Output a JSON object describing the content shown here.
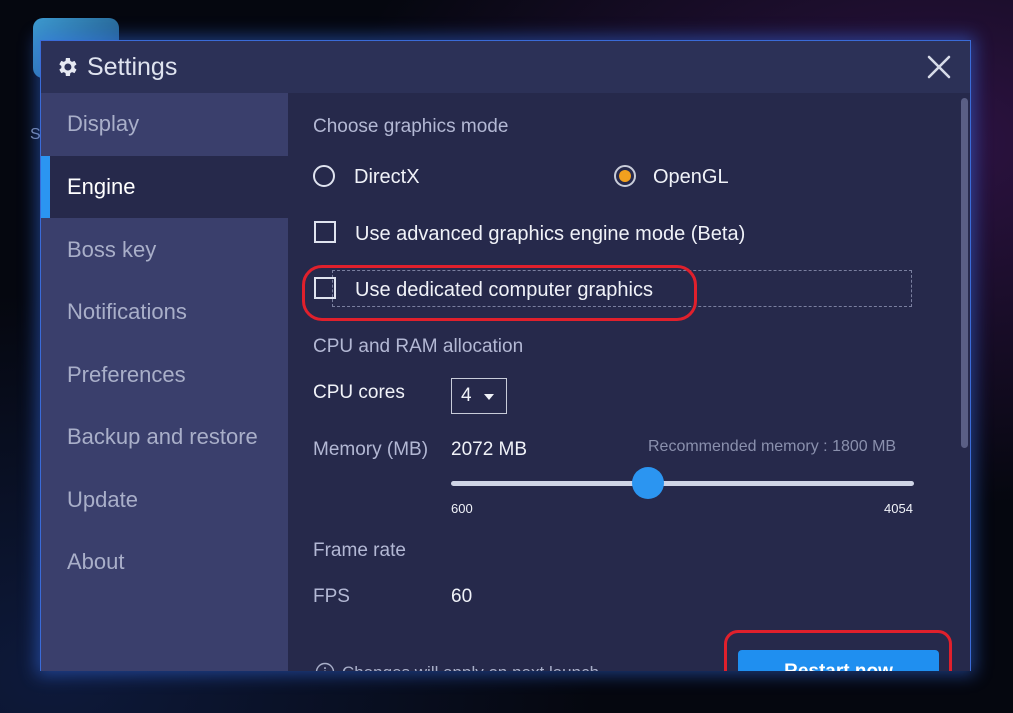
{
  "background": {
    "stray_text": "S"
  },
  "window": {
    "title": "Settings",
    "title_icon": "gear-icon",
    "close_icon": "close-icon"
  },
  "sidebar": {
    "items": [
      {
        "label": "Display",
        "active": false
      },
      {
        "label": "Engine",
        "active": true
      },
      {
        "label": "Boss key",
        "active": false
      },
      {
        "label": "Notifications",
        "active": false
      },
      {
        "label": "Preferences",
        "active": false
      },
      {
        "label": "Backup and restore",
        "active": false
      },
      {
        "label": "Update",
        "active": false
      },
      {
        "label": "About",
        "active": false
      }
    ]
  },
  "engine": {
    "graphics_mode_title": "Choose graphics mode",
    "graphics_modes": [
      {
        "label": "DirectX",
        "selected": false
      },
      {
        "label": "OpenGL",
        "selected": true
      }
    ],
    "advanced_engine_label": "Use advanced graphics engine mode (Beta)",
    "advanced_engine_checked": false,
    "dedicated_graphics_label": "Use dedicated computer graphics",
    "dedicated_graphics_checked": false,
    "cpu_ram_title": "CPU and RAM allocation",
    "cpu_cores_label": "CPU cores",
    "cpu_cores_value": "4",
    "memory_label": "Memory (MB)",
    "memory_value": "2072 MB",
    "recommended_memory": "Recommended memory : 1800 MB",
    "memory_min": "600",
    "memory_max": "4054",
    "memory_slider_value": 2072,
    "frame_rate_title": "Frame rate",
    "fps_label": "FPS",
    "fps_value": "60"
  },
  "footer": {
    "info_text": "Changes will apply on next launch",
    "restart_button": "Restart now"
  },
  "colors": {
    "accent": "#2b95f1",
    "radio_selected": "#f2a01e",
    "highlight_ring": "#e0202c",
    "dialog_bg": "#26294b",
    "sidebar_bg": "#3a3f6c"
  }
}
